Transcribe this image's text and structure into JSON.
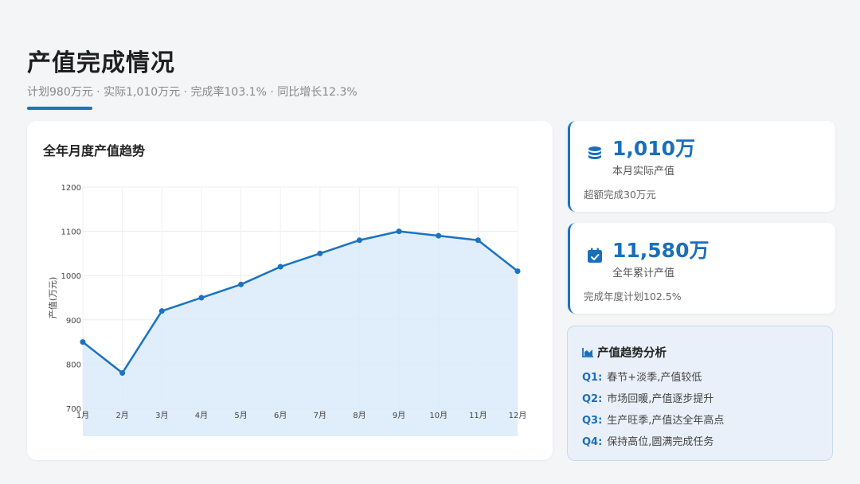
{
  "header": {
    "title": "产值完成情况",
    "subtitle": "计划980万元 · 实际1,010万元 · 完成率103.1% · 同比增长12.3%"
  },
  "chart_card": {
    "title": "全年月度产值趋势"
  },
  "chart_data": {
    "type": "area",
    "categories": [
      "1月",
      "2月",
      "3月",
      "4月",
      "5月",
      "6月",
      "7月",
      "8月",
      "9月",
      "10月",
      "11月",
      "12月"
    ],
    "values": [
      850,
      780,
      920,
      950,
      980,
      1020,
      1050,
      1080,
      1100,
      1090,
      1080,
      1010
    ],
    "ylabel": "产值(万元)",
    "xlabel": "",
    "ylim": [
      700,
      1200
    ],
    "yticks": [
      700,
      800,
      900,
      1000,
      1100,
      1200
    ],
    "grid": true,
    "colors": {
      "line": "#1a73c1",
      "fill": "#dbeafa"
    }
  },
  "kpis": [
    {
      "icon": "coins-icon",
      "value": "1,010万",
      "label": "本月实际产值",
      "note": "超额完成30万元"
    },
    {
      "icon": "calendar-check-icon",
      "value": "11,580万",
      "label": "全年累计产值",
      "note": "完成年度计划102.5%"
    }
  ],
  "analysis": {
    "icon": "chart-area-icon",
    "title": "产值趋势分析",
    "items": [
      {
        "q": "Q1:",
        "text": "春节+淡季,产值较低"
      },
      {
        "q": "Q2:",
        "text": "市场回暖,产值逐步提升"
      },
      {
        "q": "Q3:",
        "text": "生产旺季,产值达全年高点"
      },
      {
        "q": "Q4:",
        "text": "保持高位,圆满完成任务"
      }
    ]
  },
  "colors": {
    "accent": "#1a73c1",
    "background": "#f4f5f7"
  }
}
